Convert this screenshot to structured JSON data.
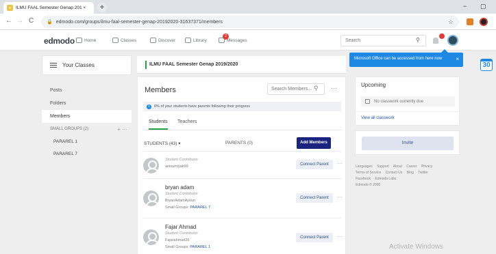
{
  "browser": {
    "tab_title": "ILMU FAAL Semester Genap 201 ×",
    "tab_close": "×",
    "new_tab": "+",
    "url": "edmodo.com/groups/ilmu-faal-semester-genap-20192020-31637371/members",
    "minimize": "−",
    "maximize": "▢"
  },
  "topnav": {
    "logo": "edmodo",
    "items": [
      {
        "label": "Home"
      },
      {
        "label": "Classes"
      },
      {
        "label": "Discover"
      },
      {
        "label": "Library"
      },
      {
        "label": "Messages"
      }
    ],
    "messages_badge": "2",
    "search_placeholder": "Search"
  },
  "tooltip": {
    "text": "Microsoft Office can be accessed from here now",
    "close": "×"
  },
  "calendar": {
    "day": "30"
  },
  "sidebar": {
    "your_classes": "Your Classes",
    "items": [
      {
        "label": "Posts"
      },
      {
        "label": "Folders"
      },
      {
        "label": "Members"
      }
    ],
    "small_groups_label": "SMALL GROUPS (2)",
    "small_groups_controls": "+ ···",
    "groups": [
      {
        "label": "PARAREL 1"
      },
      {
        "label": "PARAREL 7"
      }
    ]
  },
  "class_banner": {
    "title": "ILMU FAAL Semester Genap 2019/2020"
  },
  "members": {
    "title": "Members",
    "search_placeholder": "Search Members...",
    "info_text": "0% of your students have parents following their progress",
    "tabs": [
      {
        "label": "Students"
      },
      {
        "label": "Teachers"
      }
    ],
    "students_count": "STUDENTS (43) ▾",
    "parents_count": "PARENTS (0)",
    "add_members": "Add Members",
    "list": [
      {
        "name": "",
        "role": "Student Contributor",
        "username": "anisumiyati99",
        "group_prefix": "",
        "group": "",
        "action": "Connect Parent"
      },
      {
        "name": "bryan adam",
        "role": "Student Contributor",
        "username": "BryanAdamAyoun",
        "group_prefix": "Small Groups:",
        "group": "PARAREL 7",
        "action": "Connect Parent"
      },
      {
        "name": "Fajar Ahmad",
        "role": "Student Contributor",
        "username": "Fajarahmad26",
        "group_prefix": "Small Groups:",
        "group": "PARAREL 1",
        "action": "Connect Parent"
      }
    ]
  },
  "upcoming": {
    "title": "Upcoming",
    "empty": "No classwork currently due",
    "link": "View all classwork"
  },
  "invite": {
    "label": "Invite"
  },
  "footer": {
    "links": [
      "Languages",
      "Support",
      "About",
      "Career",
      "Privacy",
      "Terms of Service",
      "Contact Us",
      "Blog",
      "Twitter",
      "Facebook",
      "Edmodo Labs"
    ],
    "copyright": "Edmodo © 2020"
  },
  "watermark": "Activate Windows"
}
